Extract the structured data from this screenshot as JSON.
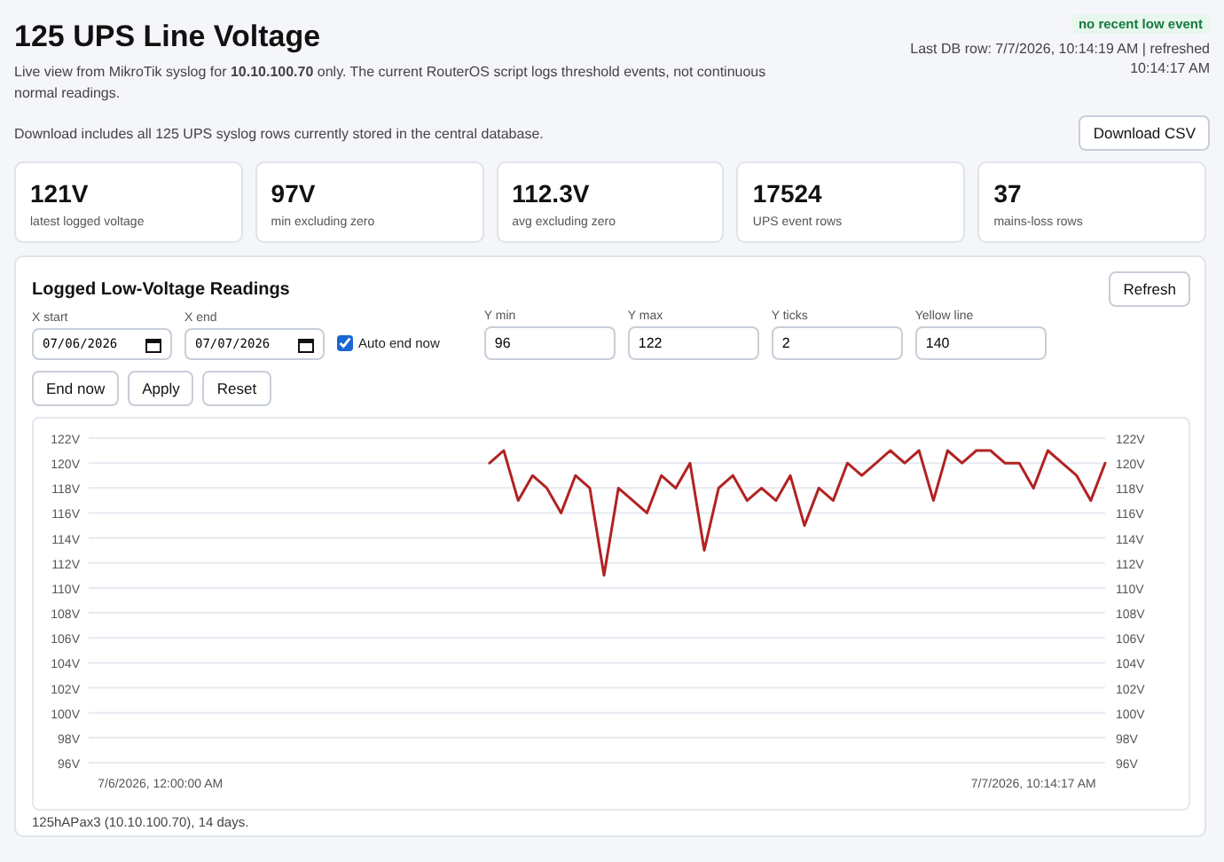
{
  "header": {
    "title": "125 UPS Line Voltage",
    "subtitle": "Live view from MikroTik syslog for **10.10.100.70** only. The current RouterOS script logs threshold events, not continuous normal readings.",
    "status_badge": "no recent low event",
    "meta": "Last DB row: 7/7/2026, 10:14:19 AM | refreshed 10:14:17 AM"
  },
  "download": {
    "note": "Download includes all 125 UPS syslog rows currently stored in the central database.",
    "button": "Download CSV"
  },
  "stats": [
    {
      "value": "121V",
      "label": "latest logged voltage"
    },
    {
      "value": "97V",
      "label": "min excluding zero"
    },
    {
      "value": "112.3V",
      "label": "avg excluding zero"
    },
    {
      "value": "17524",
      "label": "UPS event rows"
    },
    {
      "value": "37",
      "label": "mains-loss rows"
    }
  ],
  "panel": {
    "title": "Logged Low-Voltage Readings",
    "refresh_button": "Refresh",
    "x_start": {
      "label": "X start",
      "value": "07/06/2026"
    },
    "x_end": {
      "label": "X end",
      "value": "07/07/2026"
    },
    "auto_end_now": {
      "label": "Auto end now",
      "checked": true
    },
    "fields": [
      {
        "label": "Y min",
        "value": "96"
      },
      {
        "label": "Y max",
        "value": "122"
      },
      {
        "label": "Y ticks",
        "value": "2"
      },
      {
        "label": "Yellow line",
        "value": "140"
      }
    ],
    "buttons": [
      "End now",
      "Apply",
      "Reset"
    ],
    "chart_data": {
      "type": "line",
      "grid": true,
      "ylim": [
        96,
        122
      ],
      "categories": [
        null,
        null,
        null,
        null,
        null,
        "7/6/2026, 12:00:00 AM",
        null,
        null,
        null,
        null,
        null,
        null,
        null,
        null,
        null,
        null,
        null,
        null,
        null,
        null,
        null,
        null,
        null,
        null,
        null,
        null,
        null,
        null,
        null,
        null,
        null,
        null,
        null,
        null,
        null,
        null,
        null,
        null,
        null,
        null,
        null,
        null,
        null,
        null,
        null,
        null,
        null,
        null,
        null,
        null,
        null,
        null,
        null,
        null,
        null,
        null,
        null,
        null,
        null,
        null,
        null,
        null,
        null,
        null,
        null,
        null,
        "7/7/2026, 10:14:17 AM",
        null,
        null,
        null,
        null,
        null
      ],
      "yticks": [
        {
          "value": 96,
          "label": "96V"
        },
        {
          "value": 98,
          "label": "98V"
        },
        {
          "value": 100,
          "label": "100V"
        },
        {
          "value": 102,
          "label": "102V"
        },
        {
          "value": 104,
          "label": "104V"
        },
        {
          "value": 106,
          "label": "106V"
        },
        {
          "value": 108,
          "label": "108V"
        },
        {
          "value": 110,
          "label": "110V"
        },
        {
          "value": 112,
          "label": "112V"
        },
        {
          "value": 114,
          "label": "114V"
        },
        {
          "value": 116,
          "label": "116V"
        },
        {
          "value": 118,
          "label": "118V"
        },
        {
          "value": 120,
          "label": "120V"
        },
        {
          "value": 122,
          "label": "122V"
        }
      ],
      "series": [
        {
          "color": "#b22222",
          "values": [
            null,
            null,
            null,
            null,
            null,
            null,
            null,
            null,
            null,
            null,
            null,
            null,
            null,
            null,
            null,
            null,
            null,
            null,
            null,
            null,
            null,
            null,
            null,
            null,
            null,
            null,
            null,
            null,
            120,
            121,
            117,
            119,
            118,
            116,
            119,
            118,
            111,
            118,
            117,
            116,
            119,
            118,
            120,
            113,
            118,
            119,
            117,
            118,
            117,
            119,
            115,
            118,
            117,
            120,
            119,
            120,
            121,
            120,
            121,
            117,
            121,
            120,
            121,
            121,
            120,
            120,
            118,
            121,
            120,
            119,
            117,
            120
          ]
        }
      ]
    },
    "footnote": "125hAPax3 (10.10.100.70), 14 days."
  }
}
